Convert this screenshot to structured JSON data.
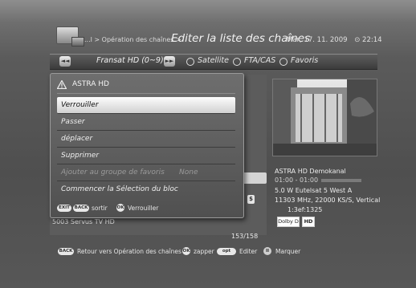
{
  "header": {
    "breadcrumb": "...l > Opération des chaînes >",
    "title": "Editer la liste des chaînes",
    "datetime": "Mar, 17. 11. 2009",
    "clock_icon": "clock-icon",
    "time": "22:14"
  },
  "filter_bar": {
    "prev_label": "◄◄",
    "favorite_list": "Fransat HD (0~9)",
    "next_label": "►►",
    "options": [
      "Satellite",
      "FTA/CAS",
      "Favoris"
    ]
  },
  "channel_list": {
    "background_channel": "5003  Servus TV HD",
    "counter": "153/158"
  },
  "channel_info": {
    "name": "ASTRA HD Demokanal",
    "time_range": "01:00 - 01:00",
    "satellite": "5.0 W Eutelsat 5 West A",
    "transponder": "11303 MHz, 22000 KS/S, Vertical",
    "service_id": "1:3ef:1325",
    "scrambled_badge": "$",
    "badges": [
      "Dolby D",
      "HD"
    ]
  },
  "popup": {
    "title": "ASTRA HD",
    "items": [
      {
        "label": "Verrouiller",
        "selected": true
      },
      {
        "label": "Passer"
      },
      {
        "label": "déplacer"
      },
      {
        "label": "Supprimer"
      },
      {
        "label": "Ajouter au groupe de favoris",
        "value": "None",
        "disabled": true
      },
      {
        "label": "Commencer la Sélection du bloc"
      }
    ],
    "footer": {
      "exit_key": "EXIT",
      "back_key": "BACK",
      "exit_text": "sortir",
      "ok_key": "OK",
      "ok_text": "Verrouiller"
    }
  },
  "bottom_bar": {
    "back_key": "BACK",
    "back_text": "Retour vers Opération des chaînes",
    "ok_key": "OK",
    "ok_text": "zapper",
    "opt_key": "opt",
    "opt_text": "Editer",
    "mark_key": "II",
    "mark_text": "Marquer"
  },
  "colors": {
    "selection": "#f2f2f2",
    "background": "#555555",
    "text": "#e6e6e6"
  }
}
